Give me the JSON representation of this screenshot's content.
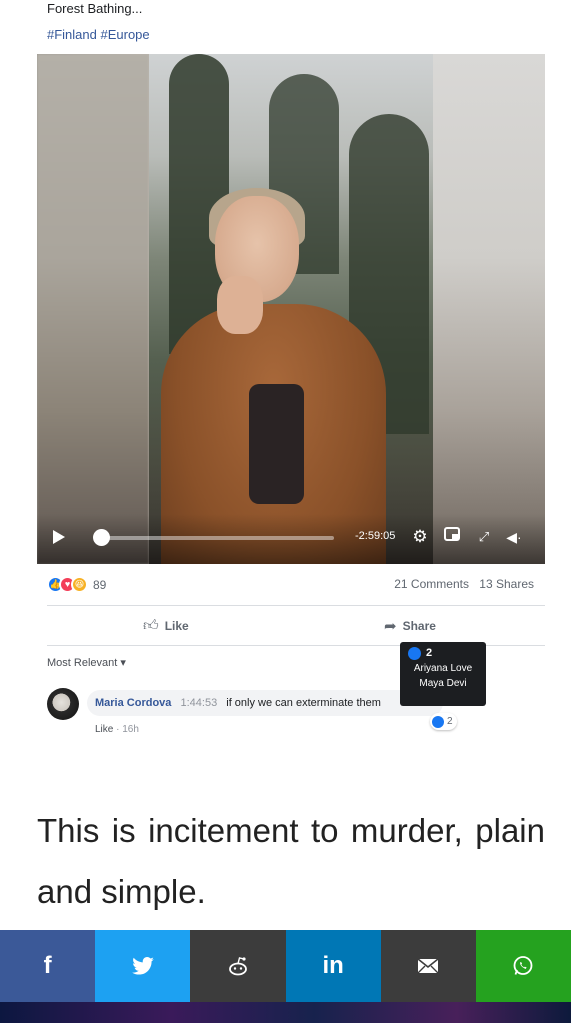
{
  "post": {
    "title": "Forest Bathing...",
    "tags": "#Finland #Europe"
  },
  "video": {
    "time_remaining": "-2:59:05",
    "progress": 0.0,
    "icons": {
      "play": "play-icon",
      "settings": "gear-icon",
      "miniplayer": "miniplayer-icon",
      "fullscreen": "expand-icon",
      "volume": "volume-icon"
    }
  },
  "stats": {
    "reaction_count": "89",
    "comments": "21 Comments",
    "shares": "13 Shares"
  },
  "actions": {
    "like_label": "Like",
    "share_label": "Share"
  },
  "comments_section": {
    "sort_label": "Most Relevant ▾",
    "tooltip": {
      "count": "2",
      "names": [
        "Ariyana Love",
        "Maya Devi"
      ]
    },
    "comment": {
      "author": "Maria Cordova",
      "timestamp": "1:44:53",
      "text": "if only we can exterminate them",
      "like_link": "Like",
      "age": "16h",
      "reaction_count": "2"
    }
  },
  "article": {
    "text": "This is incitement to murder, plain and simple."
  },
  "share_bar": {
    "buttons": [
      {
        "name": "facebook",
        "glyph": "f"
      },
      {
        "name": "twitter",
        "glyph": "🐦"
      },
      {
        "name": "reddit",
        "glyph": "👽"
      },
      {
        "name": "linkedin",
        "glyph": "in"
      },
      {
        "name": "email",
        "glyph": "✉"
      },
      {
        "name": "whatsapp",
        "glyph": "✆"
      }
    ]
  },
  "colors": {
    "facebook": "#3b5998",
    "twitter": "#1da1f2",
    "reddit": "#3c3c3c",
    "linkedin": "#0077b5",
    "email": "#3c3c3c",
    "whatsapp": "#25a21f",
    "link": "#365899"
  }
}
